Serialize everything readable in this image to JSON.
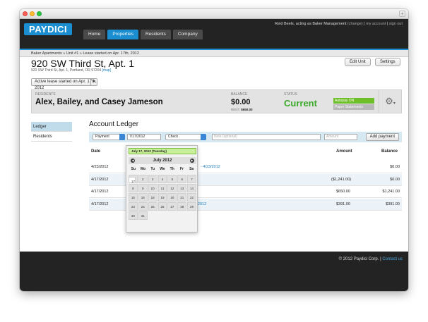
{
  "header": {
    "logo": "PAYDICI",
    "acting": "Reid Beels, acting as Baker Management",
    "change": "(change)",
    "sep": " | ",
    "my_account": "my account",
    "sign_out": "sign out",
    "tabs": [
      "Home",
      "Properties",
      "Residents",
      "Company"
    ]
  },
  "breadcrumb": "Baker Apartments » Unit #1 » Lease started on Apr. 17th, 2012",
  "unit": {
    "title": "920 SW Third St, Apt. 1",
    "address": "920 SW Third St, Apt. 1, Portland, OR 97204",
    "map": "[map]",
    "edit_label": "Edit Unit",
    "settings_label": "Settings",
    "lease_select": "Active lease started on Apr. 17th, 2012"
  },
  "resident_bar": {
    "residents_label": "RESIDENTS",
    "names": "Alex, Bailey, and Casey Jameson",
    "balance_label": "BALANCE",
    "balance": "$0.00",
    "rent_label": "RENT:",
    "rent": "$650.00",
    "status_label": "STATUS",
    "status": "Current",
    "autopay": "Autopay ON",
    "paper": "Paper Statements"
  },
  "sidenav": [
    "Ledger",
    "Residents"
  ],
  "ledger": {
    "title": "Account Ledger",
    "type": "Payment",
    "date_value": "7/17/2012",
    "method": "Check",
    "note_placeholder": "Note (optional)",
    "amount_placeholder": "Amount",
    "add_label": "Add payment",
    "columns": {
      "date": "Date",
      "amount": "Amount",
      "balance": "Balance"
    },
    "rows": [
      {
        "date": "4/23/2012",
        "desc": "- 4/23/2012",
        "amount": "",
        "balance": "$0.00"
      },
      {
        "date": "4/17/2012",
        "desc": "",
        "amount": "($1,241.00)",
        "balance": "$0.00"
      },
      {
        "date": "4/17/2012",
        "desc": "",
        "amount": "$650.00",
        "balance": "$1,241.00"
      },
      {
        "date": "4/17/2012",
        "desc": "2012",
        "amount": "$391.00",
        "balance": "$391.00"
      }
    ]
  },
  "datepicker": {
    "selected": "July 17, 2012 (Tuesday)",
    "month": "July 2012",
    "days": [
      "Su",
      "Mo",
      "Tu",
      "We",
      "Th",
      "Fr",
      "Sa"
    ],
    "dates": [
      "1",
      "2",
      "3",
      "4",
      "5",
      "6",
      "7",
      "8",
      "9",
      "10",
      "11",
      "12",
      "13",
      "14",
      "15",
      "16",
      "17",
      "18",
      "19",
      "20",
      "21",
      "22",
      "23",
      "24",
      "25",
      "26",
      "27",
      "28",
      "29",
      "30",
      "31"
    ],
    "selected_date": "17"
  },
  "footer": {
    "copyright": "© 2012 Paydici Corp.",
    "sep": " | ",
    "contact": "Contact us"
  },
  "colors": {
    "brand": "#1a8ed0",
    "status_green": "#3caa2a",
    "autopay": "#6fbf2a"
  }
}
